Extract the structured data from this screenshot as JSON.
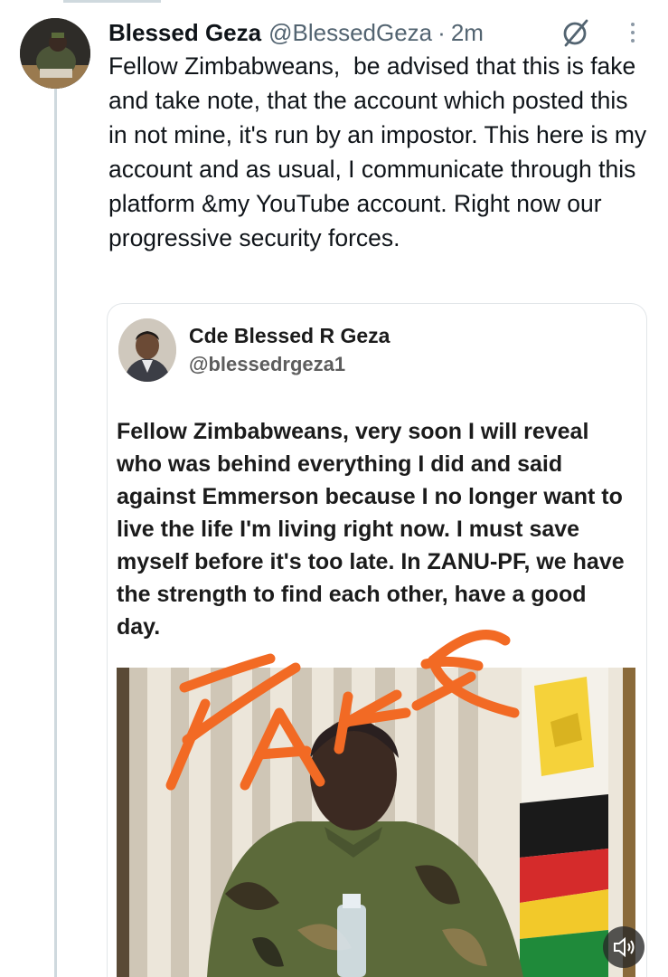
{
  "tweet": {
    "display_name": "Blessed Geza",
    "handle": "@BlessedGeza",
    "separator": "·",
    "time": "2m",
    "text": "Fellow Zimbabweans,  be advised that this is fake and take note, that the account which posted this in not mine, it's run by an impostor. This here is my account and as usual, I communicate through this platform &my YouTube account. Right now our progressive security forces.",
    "icons": {
      "grok": "grok-icon",
      "more": "more-options-icon"
    }
  },
  "quoted_post": {
    "display_name": "Cde Blessed R Geza",
    "handle": "@blessedrgeza1",
    "text": "Fellow Zimbabweans, very soon I will reveal who was behind everything I did and said against Emmerson because I no longer want to live the life I'm living right now. I must save myself before it's too late. In ZANU-PF, we have the strength to find each other, have a good day.",
    "overlay_text": "FAKE",
    "overlay_color": "#f26a24",
    "media_icon": "volume-icon"
  },
  "colors": {
    "text": "#0f1419",
    "secondary": "#536471",
    "border": "#cfd9de"
  }
}
